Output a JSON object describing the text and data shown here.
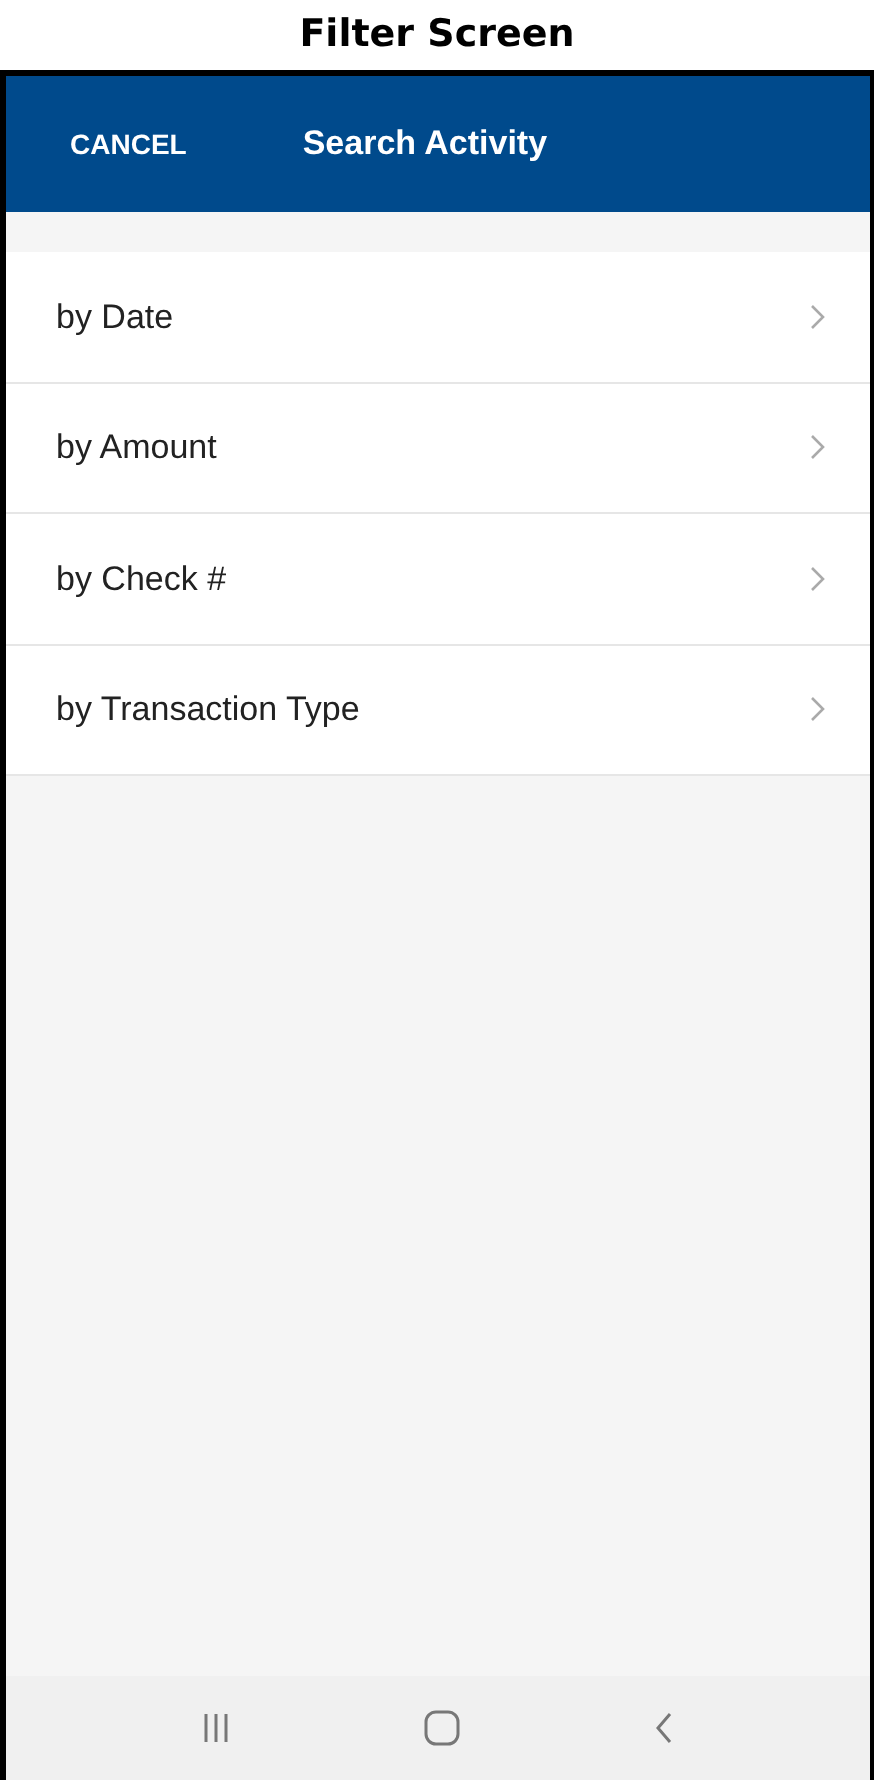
{
  "caption": "Filter Screen",
  "header": {
    "cancel": "CANCEL",
    "title": "Search Activity"
  },
  "filters": [
    {
      "label": "by Date"
    },
    {
      "label": "by Amount"
    },
    {
      "label": "by Check #"
    },
    {
      "label": "by Transaction Type"
    }
  ]
}
